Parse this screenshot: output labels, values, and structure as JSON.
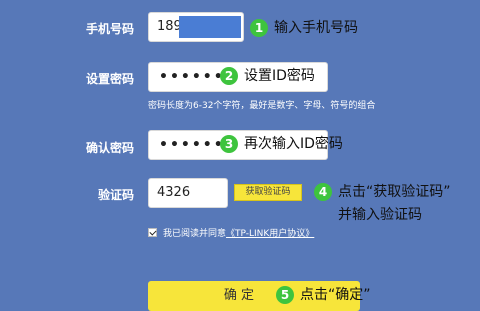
{
  "phone": {
    "label": "手机号码",
    "value_visible": "189",
    "step": "1",
    "annotation": "输入手机号码"
  },
  "set_password": {
    "label": "设置密码",
    "masked_value": "••••••",
    "step": "2",
    "annotation": "设置ID密码",
    "hint": "密码长度为6-32个字符，最好是数字、字母、符号的组合"
  },
  "confirm_password": {
    "label": "确认密码",
    "masked_value": "••••••",
    "step": "3",
    "annotation": "再次输入ID密码"
  },
  "verify_code": {
    "label": "验证码",
    "value": "4326",
    "get_code_button": "获取验证码",
    "step": "4",
    "annotation_line1": "点击“获取验证码”",
    "annotation_line2": "并输入验证码"
  },
  "agreement": {
    "checked": true,
    "prefix": "我已阅读并同意",
    "link": "《TP-LINK用户协议》"
  },
  "confirm_button": {
    "label": "确 定",
    "step": "5",
    "annotation": "点击“确定”"
  },
  "colors": {
    "background": "#5778b8",
    "step_badge": "#3ec43e",
    "button_yellow": "#f7e53a"
  }
}
